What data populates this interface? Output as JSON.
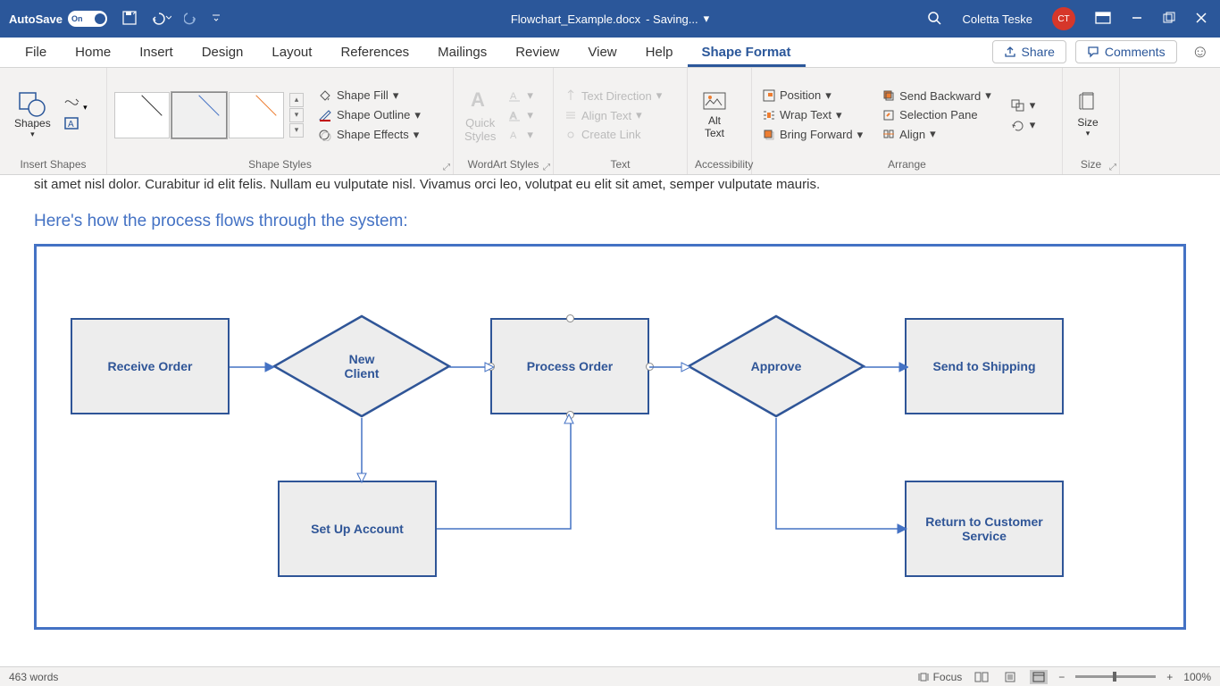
{
  "titlebar": {
    "autosave": "AutoSave",
    "autosave_state": "On",
    "doc_title": "Flowchart_Example.docx",
    "save_state": "- Saving...",
    "user": "Coletta Teske",
    "user_initials": "CT"
  },
  "tabs": [
    "File",
    "Home",
    "Insert",
    "Design",
    "Layout",
    "References",
    "Mailings",
    "Review",
    "View",
    "Help",
    "Shape Format"
  ],
  "actions": {
    "share": "Share",
    "comments": "Comments"
  },
  "ribbon": {
    "insert_shapes": {
      "label": "Insert Shapes",
      "shapes": "Shapes"
    },
    "shape_styles": {
      "label": "Shape Styles",
      "fill": "Shape Fill",
      "outline": "Shape Outline",
      "effects": "Shape Effects"
    },
    "wordart": {
      "label": "WordArt Styles",
      "quick": "Quick\nStyles"
    },
    "text": {
      "label": "Text",
      "dir": "Text Direction",
      "align": "Align Text",
      "link": "Create Link"
    },
    "acc": {
      "label": "Accessibility",
      "alt": "Alt\nText"
    },
    "arrange": {
      "label": "Arrange",
      "position": "Position",
      "wrap": "Wrap Text",
      "forward": "Bring Forward",
      "backward": "Send Backward",
      "selpane": "Selection Pane",
      "align": "Align"
    },
    "size": {
      "label": "Size",
      "size": "Size"
    }
  },
  "doc": {
    "cut_text": "sit amet nisl dolor. Curabitur id elit felis. Nullam eu vulputate nisl. Vivamus orci leo, volutpat eu elit sit amet, semper vulputate mauris.",
    "heading": "Here's how the process flows through the system:",
    "nodes": {
      "receive": "Receive Order",
      "newclient": "New\nClient",
      "process": "Process Order",
      "approve": "Approve",
      "ship": "Send to Shipping",
      "setup": "Set Up Account",
      "return": "Return to\nCustomer Service"
    }
  },
  "status": {
    "words": "463 words",
    "focus": "Focus",
    "zoom": "100%"
  }
}
